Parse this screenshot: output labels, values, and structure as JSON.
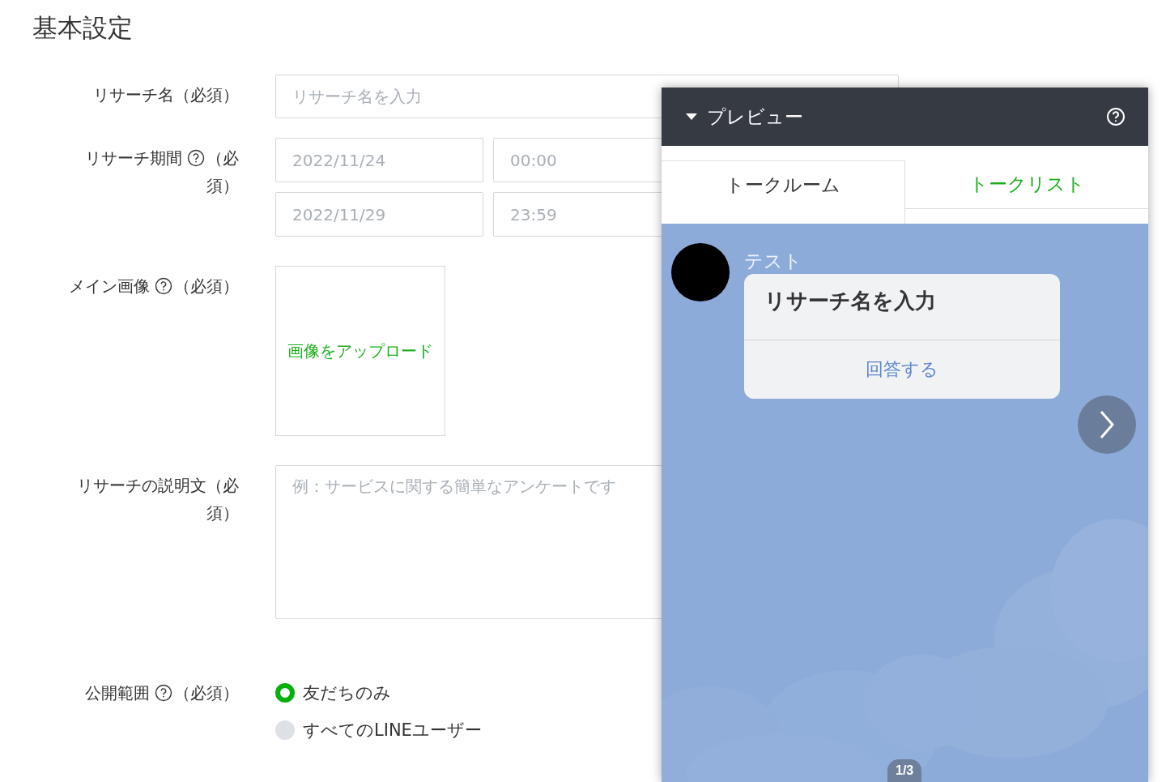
{
  "page_title": "基本設定",
  "fields": [
    {
      "kind": "text",
      "label": "リサーチ名",
      "help": false,
      "required": "（必須）",
      "placeholder": "リサーチ名を入力"
    },
    {
      "kind": "period",
      "label": "リサーチ期間",
      "help": true,
      "required": "（必須）",
      "inputs": [
        {
          "date_placeholder": "2022/11/24",
          "time_placeholder": "00:00"
        },
        {
          "date_placeholder": "2022/11/29",
          "time_placeholder": "23:59"
        }
      ]
    },
    {
      "kind": "upload",
      "label": "メイン画像",
      "help": true,
      "required": "（必須）",
      "button": "画像をアップロード"
    },
    {
      "kind": "textarea",
      "label": "リサーチの説明文",
      "help": false,
      "required": "（必須）",
      "placeholder": "例：サービスに関する簡単なアンケートです"
    },
    {
      "kind": "radio",
      "label": "公開範囲",
      "help": true,
      "required": "（必須）",
      "options": [
        {
          "label": "友だちのみ",
          "selected": true
        },
        {
          "label": "すべてのLINEユーザー",
          "selected": false
        }
      ]
    }
  ],
  "preview": {
    "title": "プレビュー",
    "expanded": true,
    "tabs": [
      {
        "label": "トークルーム",
        "selected": true
      },
      {
        "label": "トークリスト",
        "selected": false
      }
    ],
    "sender": "テスト",
    "card": {
      "title": "リサーチ名を入力",
      "action": "回答する"
    },
    "pager": "1/3"
  }
}
